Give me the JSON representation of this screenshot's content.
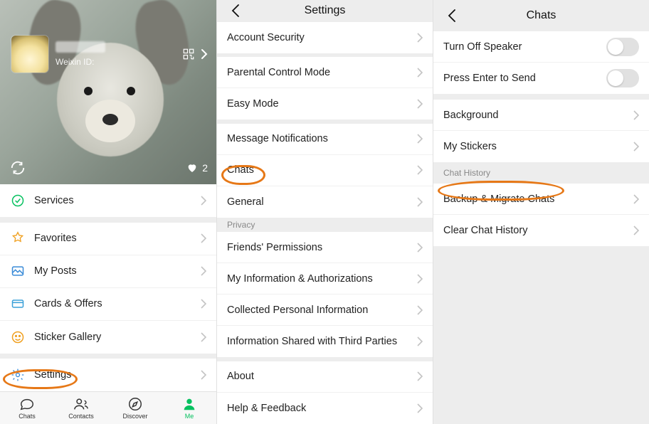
{
  "panel1": {
    "weixin_id_label": "Weixin ID:",
    "likes_count": "2",
    "menu": {
      "services": "Services",
      "favorites": "Favorites",
      "my_posts": "My Posts",
      "cards_offers": "Cards & Offers",
      "sticker_gallery": "Sticker Gallery",
      "settings": "Settings"
    },
    "tabs": {
      "chats": "Chats",
      "contacts": "Contacts",
      "discover": "Discover",
      "me": "Me"
    }
  },
  "panel2": {
    "title": "Settings",
    "items": {
      "account_security": "Account Security",
      "parental_control": "Parental Control Mode",
      "easy_mode": "Easy Mode",
      "message_notifications": "Message Notifications",
      "chats": "Chats",
      "general": "General",
      "privacy_header": "Privacy",
      "friends_permissions": "Friends' Permissions",
      "my_info_auth": "My Information & Authorizations",
      "collected_personal_info": "Collected Personal Information",
      "info_shared_third": "Information Shared with Third Parties",
      "about": "About",
      "help_feedback": "Help & Feedback"
    }
  },
  "panel3": {
    "title": "Chats",
    "items": {
      "turn_off_speaker": "Turn Off Speaker",
      "press_enter_to_send": "Press Enter to Send",
      "background": "Background",
      "my_stickers": "My Stickers",
      "chat_history_header": "Chat History",
      "backup_migrate": "Backup & Migrate Chats",
      "clear_chat_history": "Clear Chat History"
    }
  }
}
